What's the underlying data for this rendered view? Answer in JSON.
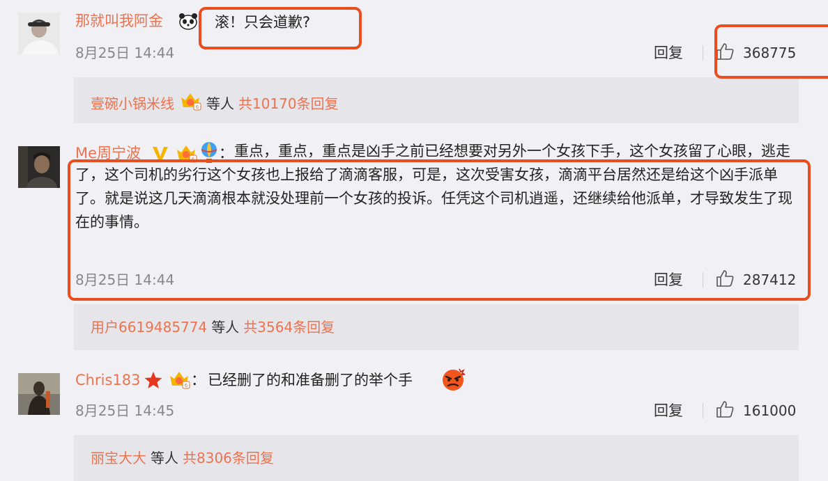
{
  "colors": {
    "accent": "#eb7350",
    "highlight": "#e94e20",
    "background": "#f1f0f4",
    "reply_box": "#e6e5ea"
  },
  "comments": [
    {
      "user": "那就叫我阿金",
      "text": "滚！只会道歉?",
      "time": "8月25日 14:44",
      "reply_label": "回复",
      "likes": "368775",
      "replies": {
        "user": "壹碗小锅米线",
        "etc": "等人",
        "count": "共10170条回复"
      }
    },
    {
      "user": "Me周宁波",
      "colon": "：",
      "text": "重点，重点，重点是凶手之前已经想要对另外一个女孩下手，这个女孩留了心眼，逃走了，这个司机的劣行这个女孩也上报给了滴滴客服，可是，这次受害女孩，滴滴平台居然还是给这个凶手派单了。就是说这几天滴滴根本就没处理前一个女孩的投诉。任凭这个司机逍遥，还继续给他派单，才导致发生了现在的事情。",
      "time": "8月25日 14:44",
      "reply_label": "回复",
      "likes": "287412",
      "replies": {
        "user": "用户6619485774",
        "etc": "等人",
        "count": "共3564条回复"
      }
    },
    {
      "user": "Chris183",
      "colon": "：",
      "text": "已经删了的和准备删了的举个手",
      "time": "8月25日 14:45",
      "reply_label": "回复",
      "likes": "161000",
      "replies": {
        "user": "丽宝大大",
        "etc": "等人",
        "count": "共8306条回复"
      }
    }
  ],
  "icons": [
    "panda-emoji-icon",
    "vip-crown-icon",
    "verified-v-icon",
    "hot-air-balloon-icon",
    "red-star-icon",
    "angry-face-emoji-icon",
    "thumbs-up-icon"
  ]
}
